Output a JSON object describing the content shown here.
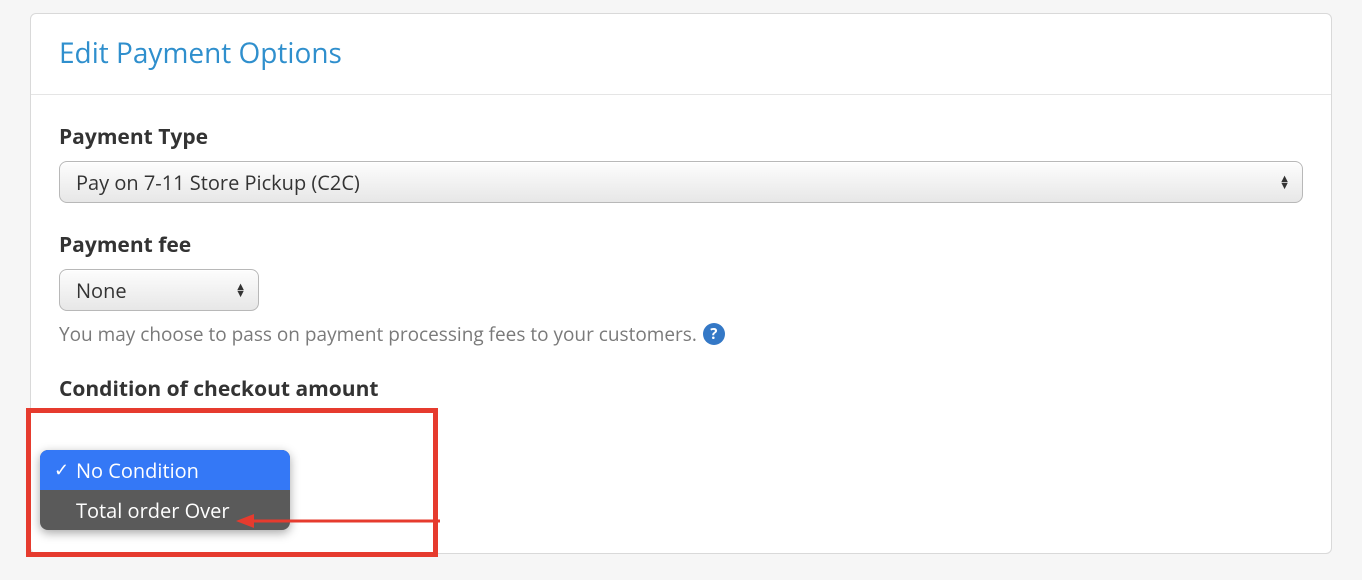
{
  "panel": {
    "title": "Edit Payment Options"
  },
  "payment_type": {
    "label": "Payment Type",
    "value": "Pay on 7-11 Store Pickup (C2C)"
  },
  "payment_fee": {
    "label": "Payment fee",
    "value": "None",
    "helper_text": "You may choose to pass on payment processing fees to your customers.",
    "help_glyph": "?"
  },
  "condition": {
    "label": "Condition of checkout amount",
    "options": [
      {
        "label": "No Condition",
        "selected": true
      },
      {
        "label": "Total order Over",
        "selected": false
      }
    ]
  }
}
